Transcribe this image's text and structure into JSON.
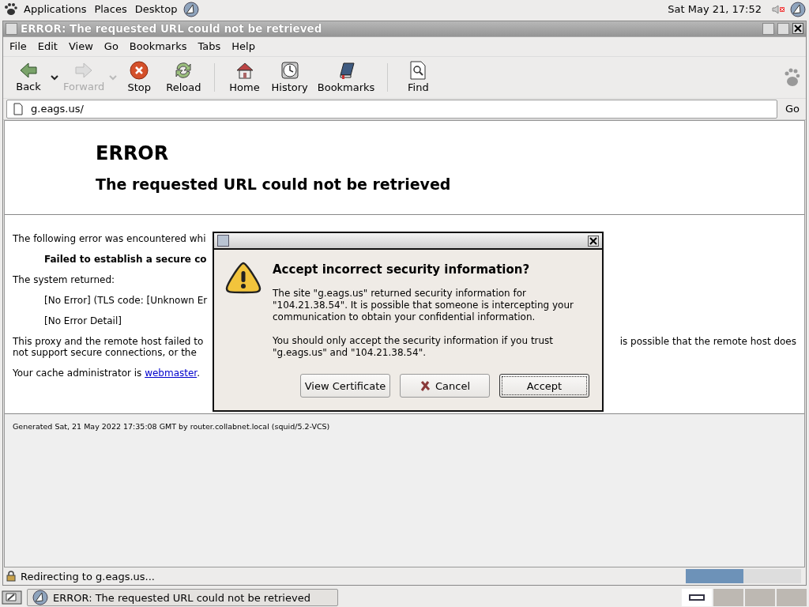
{
  "top_panel": {
    "menus": [
      "Applications",
      "Places",
      "Desktop"
    ],
    "clock": "Sat May 21, 17:52"
  },
  "window": {
    "title": "ERROR: The requested URL could not be retrieved"
  },
  "menubar": [
    "File",
    "Edit",
    "View",
    "Go",
    "Bookmarks",
    "Tabs",
    "Help"
  ],
  "toolbar": [
    [
      {
        "label": "Back",
        "kind": "back",
        "disabled": false,
        "menu": true
      },
      {
        "label": "Forward",
        "kind": "forward",
        "disabled": true,
        "menu": true
      },
      {
        "label": "Stop",
        "kind": "stop",
        "disabled": false,
        "menu": false
      },
      {
        "label": "Reload",
        "kind": "reload",
        "disabled": false,
        "menu": false
      }
    ],
    [
      {
        "label": "Home",
        "kind": "home",
        "disabled": false,
        "menu": false
      },
      {
        "label": "History",
        "kind": "history",
        "disabled": false,
        "menu": false
      },
      {
        "label": "Bookmarks",
        "kind": "bookmarks",
        "disabled": false,
        "menu": false
      }
    ],
    [
      {
        "label": "Find",
        "kind": "find",
        "disabled": false,
        "menu": false
      }
    ]
  ],
  "address_bar": {
    "value": "g.eags.us/",
    "go": "Go"
  },
  "page": {
    "heading": "ERROR",
    "subheading": "The requested URL could not be retrieved",
    "paragraphs": [
      [
        {
          "kind": "text",
          "text": "The following error was encountered whi"
        }
      ],
      [
        {
          "kind": "bold",
          "text": "Failed to establish a secure co"
        }
      ],
      [
        {
          "kind": "text",
          "text": "The system returned:"
        }
      ],
      [
        {
          "kind": "indent",
          "text": "[No Error] (TLS code: [Unknown Er"
        }
      ],
      [
        {
          "kind": "indent",
          "text": "[No Error Detail]"
        }
      ],
      [
        {
          "kind": "split",
          "text": "This proxy and the remote host failed to",
          "right": "is possible that the remote host does"
        },
        {
          "kind": "text",
          "text": "not support secure connections, or the"
        }
      ],
      [
        {
          "kind": "link",
          "text": "Your cache administrator is ",
          "link": "webmaster",
          "after": "."
        }
      ]
    ],
    "footer": "Generated Sat, 21 May 2022 17:35:08 GMT by router.collabnet.local (squid/5.2-VCS)"
  },
  "dialog": {
    "heading": "Accept incorrect security information?",
    "paragraphs": [
      "The site \"g.eags.us\" returned security information for \"104.21.38.54\". It is possible that someone is intercepting your communication to obtain your confidential information.",
      "You should only accept the security information if you trust \"g.eags.us\" and \"104.21.38.54\"."
    ],
    "buttons": [
      {
        "label": "View Certificate",
        "kind": "plain",
        "focused": false
      },
      {
        "label": "Cancel",
        "kind": "cancel",
        "focused": false
      },
      {
        "label": "Accept",
        "kind": "plain",
        "focused": true
      }
    ]
  },
  "status_bar": {
    "text": "Redirecting to g.eags.us...",
    "level": 0.5
  },
  "taskbar": {
    "tasks": [
      {
        "label": "ERROR: The requested URL could not be retrieved",
        "selected": false
      }
    ]
  }
}
